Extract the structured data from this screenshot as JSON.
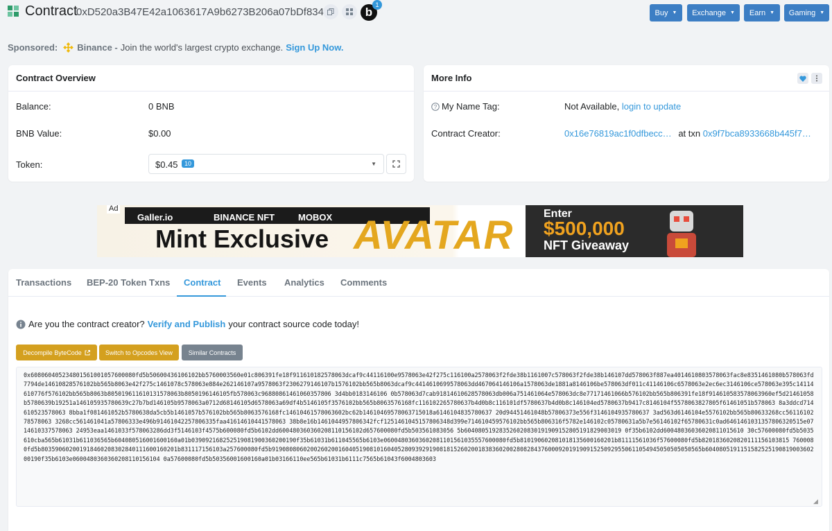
{
  "header": {
    "title": "Contract",
    "address": "0xD520a3B47E42a1063617A9b6273B206a07bDf834",
    "b_label": "b",
    "b_badge": "1",
    "menu": [
      {
        "label": "Buy"
      },
      {
        "label": "Exchange"
      },
      {
        "label": "Earn"
      },
      {
        "label": "Gaming"
      }
    ]
  },
  "sponsored": {
    "label": "Sponsored:",
    "brand": "Binance -",
    "text": "Join the world's largest crypto exchange.",
    "cta": "Sign Up Now."
  },
  "overview": {
    "title": "Contract Overview",
    "balance_label": "Balance:",
    "balance_value": "0 BNB",
    "value_label": "BNB Value:",
    "value_value": "$0.00",
    "token_label": "Token:",
    "token_value": "$0.45",
    "token_count": "10"
  },
  "more_info": {
    "title": "More Info",
    "name_tag_label": "My Name Tag:",
    "name_tag_value": "Not Available,",
    "name_tag_link": "login to update",
    "creator_label": "Contract Creator:",
    "creator_address": "0x16e76819ac1f0dfbecc…",
    "at_txn": "at txn",
    "txn_hash": "0x9f7bca8933668b445f7…"
  },
  "ad": {
    "tag": "Ad",
    "brands": [
      "Galler.io",
      "BINANCE NFT",
      "MOBOX"
    ],
    "headline": "Mint Exclusive",
    "highlight": "AVATAR",
    "enter": "Enter",
    "amount": "$500,000",
    "giveaway": "NFT Giveaway"
  },
  "tabs": [
    {
      "label": "Transactions",
      "active": false
    },
    {
      "label": "BEP-20 Token Txns",
      "active": false
    },
    {
      "label": "Contract",
      "active": true
    },
    {
      "label": "Events",
      "active": false
    },
    {
      "label": "Analytics",
      "active": false
    },
    {
      "label": "Comments",
      "active": false
    }
  ],
  "contract": {
    "question": "Are you the contract creator?",
    "verify_link": "Verify and Publish",
    "question_suffix": "your contract source code today!",
    "buttons": [
      {
        "label": "Decompile ByteCode",
        "color": "#d4a01f"
      },
      {
        "label": "Switch to Opcodes View",
        "color": "#d4a01f"
      },
      {
        "label": "Similar Contracts",
        "color": "#77838f"
      }
    ],
    "bytecode": "0x608060405234801561001057600080fd5b50600436106102bb5760003560e01c806391fe18f911610182578063dcaf9c44116100e9578063e42f275c116100a2578063f2fde38b1161007c578063f2fde38b146107dd578063f887ea4014610803578063fac8e8351461080b578063fd7794de14610828576102bb565b8063e42f275c1461078c578063e884e262146107a9578063f2306279146107b1576102bb565b8063dcaf9c4414610699578063dd467064146106a1578063de1881a8146106be578063df011c41146106c6578063e2ec6ec3146106ce578063e395c14114610776f576102bb565b8063b805019611610131578063b8050196146105fb578063c96880861461060357806 3d4bb0183146106 0b578063d7cab91814610628578063db006a751461064e578063dc8e77171461066b576102bb565b806391fe18f914610583578063960ef5d21461058b5780639b19251a146105935780639c27b7bd146105b9578063a0712d68146105d6578063a69df4b5146105f3576102bb565b8063576168fc116102265780637b4d0b8c116101df5780637b4d0b8c146104ed5780637b9417c8146104f5578063827805f61461051b578063 8a3ddcd714610523578063 8bba1f081461052b5780638da5cb5b1461057b576102bb565b8063576168fc14610461578063602bc62b14610469578063715018a6146104835780637 20d94451461048b57806373e556f3146104935780637 3ad563d6146104e5576102bb565b80633268cc5611610278578063 3268cc561461041a57806333e496b91461042257806335faa41614610441578063 38b8e16b1461044957806342fcf1251461045157806348d399e714610459576102bb565b806316f5782e146102c05780631a5b7e56146102f65780631c0ad6461461031357806320515e0714610337578063 24953eaa1461033f578063286dd3f5146103f4575b600080fd5b6102dd600480360360208110156102d657600080fd5b503561083056 5b604080519283526020830191909152805191829003019 0f35b6102dd60048036036020811015610 30c57600080fd5b5035610cba565b61031b611036565b604080516001600160a01b039092168252519081900360200190f35b61031b611045565b6103e06004803603602081101561035557600080fd5b810190602081018135600160201b81111561036f57600080fd5b8201836020820111156103815 7600080fd5b803590602001918460208302840111600160201b831117156103a257600080fd5b919080806020026020016040519081016040528093929190818152602001838360200280828437600092019190915250929550611054945050505050565b604080519115158252519081900360200190f35b6103e0600480360360208110156104 0a57600080fd5b50356001600160a01b03166110ee565b61031b6111c7565b61043f6004803603"
  }
}
